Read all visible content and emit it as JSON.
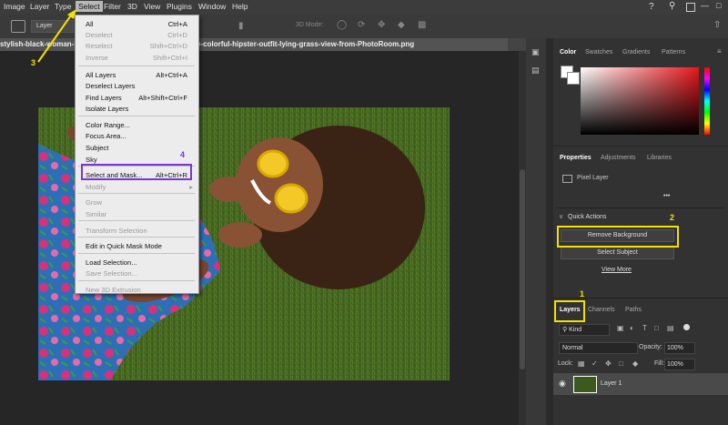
{
  "menubar": {
    "items": [
      "Image",
      "Layer",
      "Type",
      "Select",
      "Filter",
      "3D",
      "View",
      "Plugins",
      "Window",
      "Help"
    ]
  },
  "options_bar": {
    "layer_dropdown": "Layer",
    "three_d_mode": "3D Mode:"
  },
  "document_tab": {
    "title": "stylish-black-woman-list                                          g-fun-park-summer-fashion-style-colorful-hipster-outfit-lying-grass-view-from-PhotoRoom.png"
  },
  "select_menu": {
    "items": [
      {
        "label": "All",
        "shortcut": "Ctrl+A",
        "disabled": false
      },
      {
        "label": "Deselect",
        "shortcut": "Ctrl+D",
        "disabled": true
      },
      {
        "label": "Reselect",
        "shortcut": "Shift+Ctrl+D",
        "disabled": true
      },
      {
        "label": "Inverse",
        "shortcut": "Shift+Ctrl+I",
        "disabled": true
      },
      {
        "label": "All Layers",
        "shortcut": "Alt+Ctrl+A",
        "disabled": false
      },
      {
        "label": "Deselect Layers",
        "shortcut": "",
        "disabled": false
      },
      {
        "label": "Find Layers",
        "shortcut": "Alt+Shift+Ctrl+F",
        "disabled": false
      },
      {
        "label": "Isolate Layers",
        "shortcut": "",
        "disabled": false
      },
      {
        "label": "Color Range...",
        "shortcut": "",
        "disabled": false
      },
      {
        "label": "Focus Area...",
        "shortcut": "",
        "disabled": false
      },
      {
        "label": "Subject",
        "shortcut": "",
        "disabled": false
      },
      {
        "label": "Sky",
        "shortcut": "",
        "disabled": false
      },
      {
        "label": "Select and Mask...",
        "shortcut": "Alt+Ctrl+R",
        "disabled": false
      },
      {
        "label": "Modify",
        "shortcut": "",
        "disabled": true
      },
      {
        "label": "Grow",
        "shortcut": "",
        "disabled": true
      },
      {
        "label": "Similar",
        "shortcut": "",
        "disabled": true
      },
      {
        "label": "Transform Selection",
        "shortcut": "",
        "disabled": true
      },
      {
        "label": "Edit in Quick Mask Mode",
        "shortcut": "",
        "disabled": false
      },
      {
        "label": "Load Selection...",
        "shortcut": "",
        "disabled": false
      },
      {
        "label": "Save Selection...",
        "shortcut": "",
        "disabled": true
      },
      {
        "label": "New 3D Extrusion",
        "shortcut": "",
        "disabled": true
      }
    ]
  },
  "annotations": {
    "step1": "1",
    "step2": "2",
    "step3": "3",
    "step4": "4",
    "yellow": "#f4e100",
    "purple": "#7a35d6"
  },
  "color_panel": {
    "tabs": [
      "Color",
      "Swatches",
      "Gradients",
      "Patterns"
    ]
  },
  "properties_panel": {
    "tabs": [
      "Properties",
      "Adjustments",
      "Libraries"
    ],
    "pixel_layer": "Pixel Layer",
    "more": "•••",
    "quick_actions": "Quick Actions",
    "remove_background": "Remove Background",
    "select_subject": "Select Subject",
    "view_more": "View More"
  },
  "layers_panel": {
    "tabs": [
      "Layers",
      "Channels",
      "Paths"
    ],
    "kind": "Kind",
    "blend_mode": "Normal",
    "opacity_label": "Opacity:",
    "opacity": "100%",
    "lock_label": "Lock:",
    "fill_label": "Fill:",
    "fill": "100%",
    "layer_name": "Layer 1"
  }
}
